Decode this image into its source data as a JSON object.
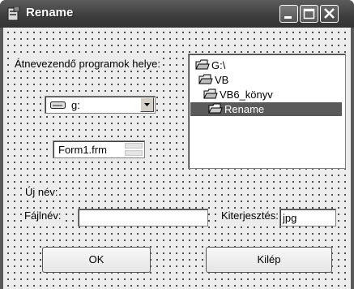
{
  "window": {
    "title": "Rename"
  },
  "labels": {
    "programs_location": "Átnevezendő programok helye:",
    "new_name": "Új név:",
    "filename": "Fájlnév:",
    "extension": "Kiterjesztés:"
  },
  "drive_combo": {
    "value": "g:"
  },
  "file_spin": {
    "value": "Form1.frm"
  },
  "folder_tree": {
    "items": [
      {
        "label": "G:\\",
        "selected": false
      },
      {
        "label": "VB",
        "selected": false
      },
      {
        "label": "VB6_könyv",
        "selected": false
      },
      {
        "label": "Rename",
        "selected": true
      }
    ]
  },
  "fields": {
    "filename_value": "",
    "extension_value": "jpg"
  },
  "buttons": {
    "ok": "OK",
    "exit": "Kilép"
  },
  "icons": {
    "title": "app-icon",
    "minimize": "minimize-icon",
    "maximize": "maximize-icon",
    "close": "close-icon",
    "drive": "drive-icon",
    "folder": "folder-icon",
    "open_folder": "open-folder-icon"
  }
}
